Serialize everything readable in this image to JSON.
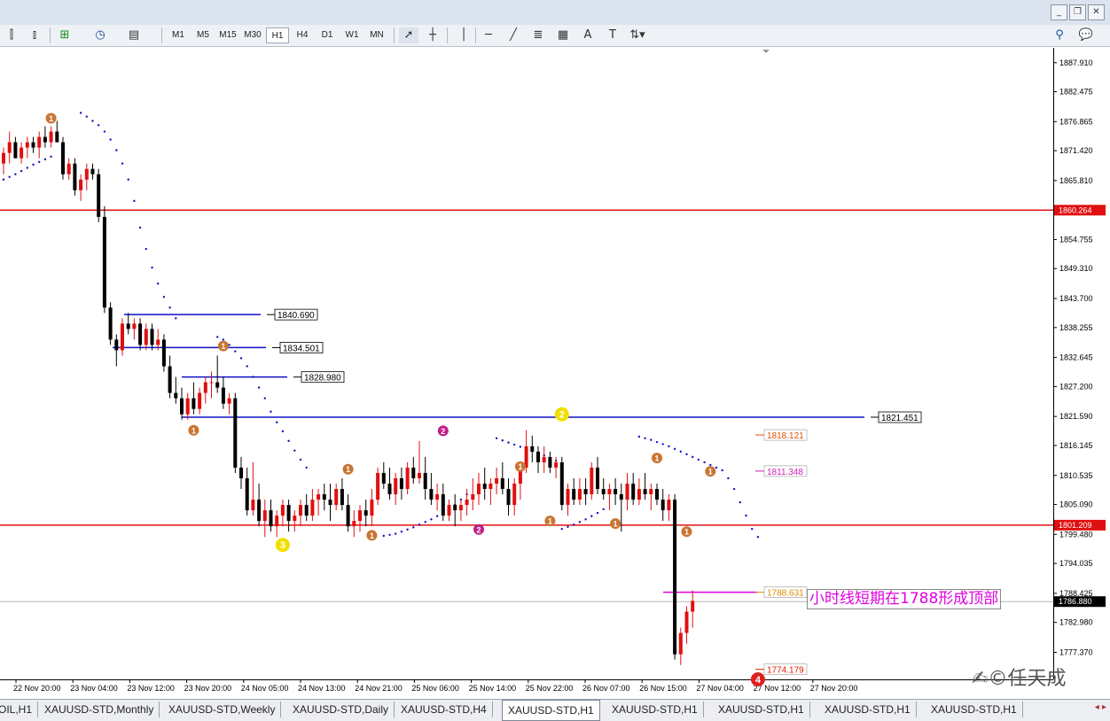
{
  "window": {
    "min": "_",
    "restore": "❐",
    "close": "✕"
  },
  "toolbar": {
    "timeframes": [
      "M1",
      "M5",
      "M15",
      "M30",
      "H1",
      "H4",
      "D1",
      "W1",
      "MN"
    ],
    "active_timeframe": "H1",
    "icons": [
      "bar-chart-icon",
      "candle-chart-icon",
      "new-chart-icon",
      "clock-icon",
      "template-icon",
      "cursor-icon",
      "crosshair-icon",
      "vertical-line-icon",
      "horizontal-line-icon",
      "trendline-icon",
      "fibo-icon",
      "channel-icon",
      "text-icon",
      "text-label-icon",
      "arrows-icon",
      "search-icon",
      "chat-icon"
    ],
    "text_tool_label": "A",
    "label_tool_label": "T"
  },
  "chart_data": {
    "type": "candlestick",
    "symbol": "XAUUSD-STD,H1",
    "ylim": [
      1772.3,
      1890.7
    ],
    "y_ticks": [
      "1887.910",
      "1882.475",
      "1876.865",
      "1871.420",
      "1865.810",
      "1860.264",
      "1854.755",
      "1849.310",
      "1843.700",
      "1838.255",
      "1832.645",
      "1827.200",
      "1821.590",
      "1816.145",
      "1810.535",
      "1805.090",
      "1801.209",
      "1799.480",
      "1794.035",
      "1788.425",
      "1786.880",
      "1782.980",
      "1777.370"
    ],
    "x_ticks": [
      "22 Nov 20:00",
      "23 Nov 04:00",
      "23 Nov 12:00",
      "23 Nov 20:00",
      "24 Nov 05:00",
      "24 Nov 13:00",
      "24 Nov 21:00",
      "25 Nov 06:00",
      "25 Nov 14:00",
      "25 Nov 22:00",
      "26 Nov 07:00",
      "26 Nov 15:00",
      "27 Nov 04:00",
      "27 Nov 12:00",
      "27 Nov 20:00"
    ],
    "current_price": "1786.880",
    "red_levels": [
      {
        "value": 1860.264,
        "label": "1860.264"
      },
      {
        "value": 1801.209,
        "label": "1801.209"
      }
    ],
    "blue_levels": [
      {
        "value": 1840.69,
        "label": "1840.690"
      },
      {
        "value": 1834.501,
        "label": "1834.501"
      },
      {
        "value": 1828.98,
        "label": "1828.980"
      },
      {
        "value": 1821.451,
        "label": "1821.451"
      }
    ],
    "right_labels": [
      {
        "value": 1818.121,
        "label": "1818.121",
        "color": "#e05000"
      },
      {
        "value": 1811.348,
        "label": "1811.348",
        "color": "#d020b0"
      },
      {
        "value": 1788.631,
        "label": "1788.631",
        "color": "#e08a00"
      },
      {
        "value": 1774.179,
        "label": "1774.179",
        "color": "#e02000"
      }
    ],
    "magenta_level": {
      "value": 1788.631
    },
    "markers": [
      {
        "t": 8,
        "v": 1877.5,
        "label": "1",
        "color": "#c87533"
      },
      {
        "t": 37,
        "v": 1834.8,
        "label": "1",
        "color": "#c87533"
      },
      {
        "t": 32,
        "v": 1819.0,
        "label": "1",
        "color": "#c87533"
      },
      {
        "t": 47,
        "v": 1797.5,
        "label": "3",
        "color": "#f0e000",
        "big": true
      },
      {
        "t": 58,
        "v": 1811.7,
        "label": "1",
        "color": "#c87533"
      },
      {
        "t": 62,
        "v": 1799.3,
        "label": "1",
        "color": "#c87533"
      },
      {
        "t": 74,
        "v": 1818.9,
        "label": "2",
        "color": "#c0208a"
      },
      {
        "t": 80,
        "v": 1800.4,
        "label": "2",
        "color": "#c0208a"
      },
      {
        "t": 87,
        "v": 1812.2,
        "label": "1",
        "color": "#c87533"
      },
      {
        "t": 92,
        "v": 1802.0,
        "label": "1",
        "color": "#c87533"
      },
      {
        "t": 94,
        "v": 1822.0,
        "label": "2",
        "color": "#f0e000",
        "big": true
      },
      {
        "t": 103,
        "v": 1801.5,
        "label": "1",
        "color": "#c87533"
      },
      {
        "t": 110,
        "v": 1813.8,
        "label": "1",
        "color": "#c87533"
      },
      {
        "t": 115,
        "v": 1800.0,
        "label": "1",
        "color": "#c87533"
      },
      {
        "t": 119,
        "v": 1811.3,
        "label": "1",
        "color": "#c87533"
      },
      {
        "t": 127,
        "v": 1772.3,
        "label": "4",
        "color": "#e02020",
        "big": true
      }
    ],
    "candles": [
      [
        1869,
        1872,
        1867,
        1871
      ],
      [
        1871,
        1875,
        1869,
        1873
      ],
      [
        1873,
        1874,
        1870,
        1870
      ],
      [
        1870,
        1873,
        1869,
        1872
      ],
      [
        1872,
        1874,
        1870,
        1873
      ],
      [
        1873,
        1874,
        1871,
        1872
      ],
      [
        1872,
        1875,
        1870,
        1874
      ],
      [
        1874,
        1876,
        1872,
        1873
      ],
      [
        1873,
        1876,
        1872,
        1875
      ],
      [
        1875,
        1877,
        1873,
        1873
      ],
      [
        1873,
        1874,
        1866,
        1867
      ],
      [
        1867,
        1870,
        1866,
        1869
      ],
      [
        1869,
        1870,
        1863,
        1864
      ],
      [
        1864,
        1867,
        1862,
        1866
      ],
      [
        1866,
        1869,
        1864,
        1868
      ],
      [
        1868,
        1869,
        1866,
        1867
      ],
      [
        1867,
        1868,
        1858,
        1859
      ],
      [
        1859,
        1861,
        1841,
        1842
      ],
      [
        1842,
        1843,
        1835,
        1836
      ],
      [
        1836,
        1837,
        1831,
        1834
      ],
      [
        1834,
        1840,
        1833,
        1839
      ],
      [
        1839,
        1841,
        1837,
        1838
      ],
      [
        1838,
        1840,
        1836,
        1839
      ],
      [
        1839,
        1840,
        1834,
        1835
      ],
      [
        1835,
        1839,
        1834,
        1838
      ],
      [
        1838,
        1839,
        1834,
        1835
      ],
      [
        1835,
        1838,
        1834,
        1836
      ],
      [
        1836,
        1837,
        1830,
        1831
      ],
      [
        1831,
        1833,
        1825,
        1826
      ],
      [
        1826,
        1829,
        1824,
        1825
      ],
      [
        1825,
        1827,
        1821,
        1822
      ],
      [
        1822,
        1826,
        1821,
        1825
      ],
      [
        1825,
        1828,
        1822,
        1823
      ],
      [
        1823,
        1827,
        1822,
        1826
      ],
      [
        1826,
        1829,
        1824,
        1828
      ],
      [
        1828,
        1830,
        1825,
        1828
      ],
      [
        1828,
        1833,
        1826,
        1827
      ],
      [
        1827,
        1829,
        1823,
        1824
      ],
      [
        1824,
        1826,
        1822,
        1825
      ],
      [
        1825,
        1826,
        1811,
        1812
      ],
      [
        1812,
        1814,
        1808,
        1810
      ],
      [
        1810,
        1812,
        1803,
        1804
      ],
      [
        1804,
        1813,
        1803,
        1806
      ],
      [
        1806,
        1809,
        1801,
        1802
      ],
      [
        1802,
        1806,
        1799,
        1804
      ],
      [
        1804,
        1806,
        1800,
        1801
      ],
      [
        1801,
        1804,
        1799,
        1803
      ],
      [
        1803,
        1806,
        1801,
        1805
      ],
      [
        1805,
        1806,
        1800,
        1802
      ],
      [
        1802,
        1804,
        1800,
        1803
      ],
      [
        1803,
        1806,
        1801,
        1805
      ],
      [
        1805,
        1807,
        1802,
        1803
      ],
      [
        1803,
        1808,
        1802,
        1806
      ],
      [
        1806,
        1808,
        1803,
        1807
      ],
      [
        1807,
        1809,
        1804,
        1806
      ],
      [
        1806,
        1809,
        1802,
        1805
      ],
      [
        1805,
        1809,
        1804,
        1808
      ],
      [
        1808,
        1810,
        1804,
        1805
      ],
      [
        1805,
        1807,
        1800,
        1801
      ],
      [
        1801,
        1804,
        1799,
        1802
      ],
      [
        1802,
        1805,
        1800,
        1804
      ],
      [
        1804,
        1806,
        1801,
        1803
      ],
      [
        1803,
        1808,
        1801,
        1806
      ],
      [
        1806,
        1812,
        1805,
        1811
      ],
      [
        1811,
        1813,
        1808,
        1809
      ],
      [
        1809,
        1812,
        1806,
        1807
      ],
      [
        1807,
        1811,
        1805,
        1810
      ],
      [
        1810,
        1812,
        1806,
        1808
      ],
      [
        1808,
        1813,
        1807,
        1812
      ],
      [
        1812,
        1814,
        1809,
        1810
      ],
      [
        1810,
        1817,
        1809,
        1811
      ],
      [
        1811,
        1814,
        1806,
        1808
      ],
      [
        1808,
        1811,
        1805,
        1806
      ],
      [
        1806,
        1809,
        1804,
        1807
      ],
      [
        1807,
        1809,
        1802,
        1803
      ],
      [
        1803,
        1806,
        1802,
        1805
      ],
      [
        1805,
        1807,
        1801,
        1804
      ],
      [
        1804,
        1806,
        1802,
        1805
      ],
      [
        1805,
        1808,
        1803,
        1806
      ],
      [
        1806,
        1810,
        1804,
        1807
      ],
      [
        1807,
        1811,
        1805,
        1809
      ],
      [
        1809,
        1812,
        1806,
        1808
      ],
      [
        1808,
        1810,
        1805,
        1809
      ],
      [
        1809,
        1812,
        1807,
        1810
      ],
      [
        1810,
        1813,
        1807,
        1808
      ],
      [
        1808,
        1810,
        1803,
        1805
      ],
      [
        1805,
        1810,
        1803,
        1809
      ],
      [
        1809,
        1813,
        1806,
        1812
      ],
      [
        1812,
        1819,
        1811,
        1816
      ],
      [
        1816,
        1818,
        1813,
        1815
      ],
      [
        1815,
        1816,
        1811,
        1813
      ],
      [
        1813,
        1816,
        1811,
        1814
      ],
      [
        1814,
        1815,
        1811,
        1812
      ],
      [
        1812,
        1814,
        1810,
        1813
      ],
      [
        1813,
        1814,
        1804,
        1805
      ],
      [
        1805,
        1809,
        1803,
        1808
      ],
      [
        1808,
        1810,
        1805,
        1806
      ],
      [
        1806,
        1810,
        1805,
        1808
      ],
      [
        1808,
        1810,
        1805,
        1807
      ],
      [
        1807,
        1813,
        1806,
        1812
      ],
      [
        1812,
        1814,
        1807,
        1808
      ],
      [
        1808,
        1810,
        1806,
        1807
      ],
      [
        1807,
        1809,
        1804,
        1808
      ],
      [
        1808,
        1810,
        1805,
        1807
      ],
      [
        1807,
        1809,
        1800,
        1806
      ],
      [
        1806,
        1811,
        1804,
        1809
      ],
      [
        1809,
        1811,
        1805,
        1806
      ],
      [
        1806,
        1810,
        1805,
        1808
      ],
      [
        1808,
        1811,
        1806,
        1807
      ],
      [
        1807,
        1809,
        1804,
        1808
      ],
      [
        1808,
        1809,
        1805,
        1806
      ],
      [
        1806,
        1808,
        1802,
        1804
      ],
      [
        1804,
        1807,
        1802,
        1806
      ],
      [
        1806,
        1807,
        1776,
        1777
      ],
      [
        1777,
        1782,
        1775,
        1781
      ],
      [
        1781,
        1786,
        1779,
        1785
      ],
      [
        1785,
        1789,
        1782,
        1787
      ]
    ],
    "psar_above": [
      [
        13,
        1878.5
      ],
      [
        14,
        1877.8
      ],
      [
        15,
        1877
      ],
      [
        16,
        1876.2
      ],
      [
        17,
        1875
      ],
      [
        18,
        1873.5
      ],
      [
        19,
        1871.5
      ],
      [
        20,
        1869
      ],
      [
        21,
        1866
      ],
      [
        22,
        1862
      ],
      [
        23,
        1857
      ],
      [
        24,
        1853
      ],
      [
        25,
        1849.5
      ],
      [
        26,
        1846.5
      ],
      [
        27,
        1844
      ],
      [
        28,
        1842
      ],
      [
        29,
        1840
      ],
      [
        36,
        1836.5
      ],
      [
        37,
        1836
      ],
      [
        38,
        1835
      ],
      [
        39,
        1833.8
      ],
      [
        40,
        1832.5
      ],
      [
        41,
        1831
      ],
      [
        42,
        1829
      ],
      [
        43,
        1827
      ],
      [
        44,
        1825
      ],
      [
        45,
        1822.5
      ],
      [
        46,
        1820.5
      ],
      [
        47,
        1818.8
      ],
      [
        48,
        1817
      ],
      [
        49,
        1815.2
      ],
      [
        50,
        1813.5
      ],
      [
        51,
        1812
      ],
      [
        83,
        1817.5
      ],
      [
        84,
        1817.1
      ],
      [
        85,
        1816.7
      ],
      [
        86,
        1816.3
      ],
      [
        87,
        1815.9
      ],
      [
        88,
        1815.5
      ],
      [
        89,
        1815.1
      ],
      [
        90,
        1814.7
      ],
      [
        91,
        1814.3
      ],
      [
        92,
        1813.8
      ],
      [
        93,
        1813.3
      ],
      [
        107,
        1817.8
      ],
      [
        108,
        1817.5
      ],
      [
        109,
        1817.2
      ],
      [
        110,
        1816.8
      ],
      [
        111,
        1816.4
      ],
      [
        112,
        1816
      ],
      [
        113,
        1815.5
      ],
      [
        114,
        1815
      ],
      [
        115,
        1814.5
      ],
      [
        116,
        1814
      ],
      [
        117,
        1813.5
      ],
      [
        118,
        1813
      ],
      [
        119,
        1812.5
      ],
      [
        120,
        1812
      ],
      [
        121,
        1811.5
      ],
      [
        122,
        1810
      ],
      [
        123,
        1808
      ],
      [
        124,
        1805.5
      ],
      [
        125,
        1803
      ],
      [
        126,
        1800.5
      ],
      [
        127,
        1799
      ]
    ],
    "psar_below": [
      [
        0,
        1866
      ],
      [
        1,
        1866.5
      ],
      [
        2,
        1867
      ],
      [
        3,
        1867.6
      ],
      [
        4,
        1868.2
      ],
      [
        5,
        1868.8
      ],
      [
        6,
        1869.3
      ],
      [
        7,
        1869.8
      ],
      [
        8,
        1870.3
      ],
      [
        64,
        1799.2
      ],
      [
        65,
        1799.4
      ],
      [
        66,
        1799.6
      ],
      [
        67,
        1800
      ],
      [
        68,
        1800.4
      ],
      [
        69,
        1800.8
      ],
      [
        70,
        1801.3
      ],
      [
        71,
        1801.8
      ],
      [
        72,
        1802.3
      ],
      [
        73,
        1802.9
      ],
      [
        74,
        1803.5
      ],
      [
        75,
        1804.2
      ],
      [
        76,
        1805
      ],
      [
        77,
        1806
      ],
      [
        78,
        1807
      ],
      [
        94,
        1800.5
      ],
      [
        95,
        1800.9
      ],
      [
        96,
        1801.3
      ],
      [
        97,
        1801.8
      ],
      [
        98,
        1802.3
      ],
      [
        99,
        1802.9
      ],
      [
        100,
        1803.5
      ],
      [
        101,
        1804.2
      ]
    ]
  },
  "annotation": "小时线短期在1788形成顶部",
  "tabs": [
    "OIL,H1",
    "XAUUSD-STD,Monthly",
    "XAUUSD-STD,Weekly",
    "XAUUSD-STD,Daily",
    "XAUUSD-STD,H4",
    "XAUUSD-STD,H1",
    "XAUUSD-STD,H1",
    "XAUUSD-STD,H1",
    "XAUUSD-STD,H1",
    "XAUUSD-STD,H1"
  ],
  "active_tab": 5,
  "watermark": "任天成"
}
